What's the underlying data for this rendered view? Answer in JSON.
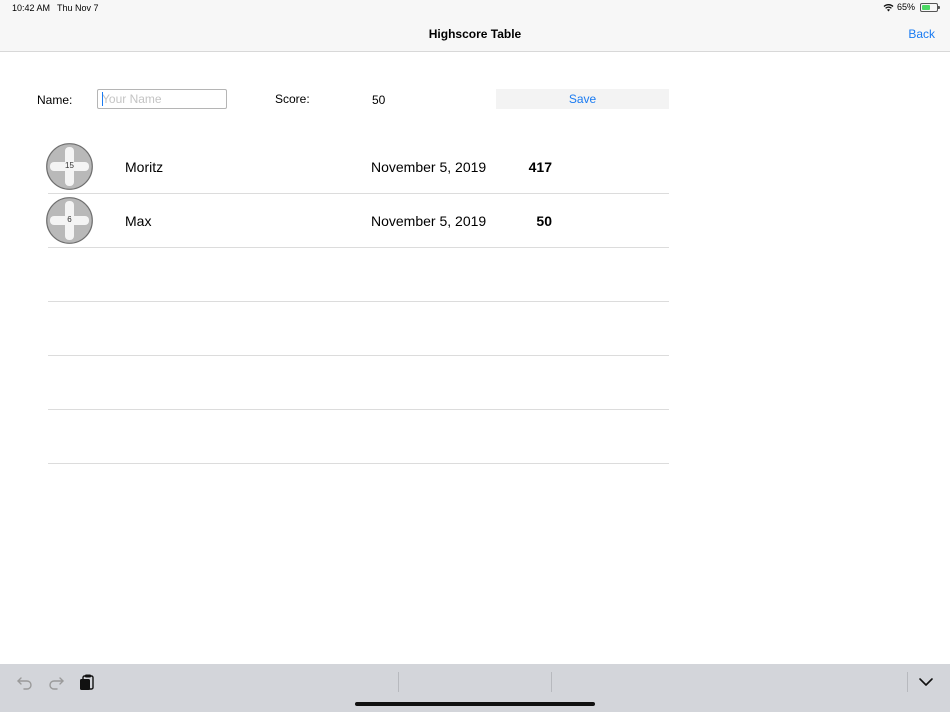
{
  "status_bar": {
    "time": "10:42 AM",
    "date": "Thu Nov 7",
    "battery": "65%"
  },
  "nav": {
    "title": "Highscore Table",
    "back_label": "Back"
  },
  "form": {
    "name_label": "Name:",
    "name_placeholder": "Your Name",
    "name_value": "",
    "score_label": "Score:",
    "score_value": "50",
    "save_label": "Save"
  },
  "table": {
    "rows": [
      {
        "avatar_number": "15",
        "name": "Moritz",
        "date": "November 5, 2019",
        "score": "417"
      },
      {
        "avatar_number": "6",
        "name": "Max",
        "date": "November 5, 2019",
        "score": "50"
      },
      {
        "avatar_number": "",
        "name": "",
        "date": "",
        "score": ""
      },
      {
        "avatar_number": "",
        "name": "",
        "date": "",
        "score": ""
      },
      {
        "avatar_number": "",
        "name": "",
        "date": "",
        "score": ""
      },
      {
        "avatar_number": "",
        "name": "",
        "date": "",
        "score": ""
      }
    ]
  },
  "icons": {
    "undo": "undo-icon",
    "redo": "redo-icon",
    "paste": "paste-icon",
    "collapse": "chevron-down-icon",
    "wifi": "wifi-icon",
    "battery": "battery-icon"
  },
  "colors": {
    "accent": "#1a7bf2",
    "battery_fill": "#4cd964"
  }
}
